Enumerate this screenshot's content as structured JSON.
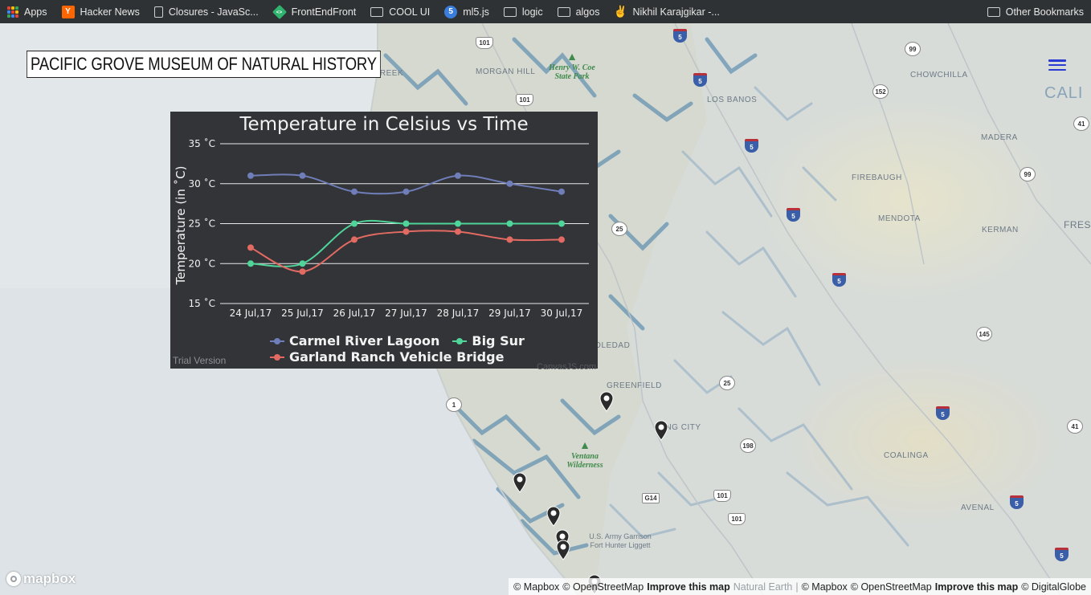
{
  "bookmarks": {
    "items": [
      {
        "label": "Apps",
        "icon": "apps-grid-icon"
      },
      {
        "label": "Hacker News",
        "icon": "hacker-news-icon"
      },
      {
        "label": "Closures - JavaSc...",
        "icon": "document-icon"
      },
      {
        "label": "FrontEndFront",
        "icon": "frontendfront-icon"
      },
      {
        "label": "COOL UI",
        "icon": "folder-icon"
      },
      {
        "label": "ml5.js",
        "icon": "ml5-icon"
      },
      {
        "label": "logic",
        "icon": "folder-icon"
      },
      {
        "label": "algos",
        "icon": "folder-icon"
      },
      {
        "label": "Nikhil Karajgikar -...",
        "icon": "peace-hand-icon"
      }
    ],
    "other": {
      "label": "Other Bookmarks",
      "icon": "folder-icon"
    }
  },
  "app": {
    "title": "PACIFIC GROVE MUSEUM OF NATURAL HISTORY",
    "menu_icon": "hamburger-menu-icon",
    "accent": "#2b3bd3"
  },
  "map": {
    "places": [
      "BOULDER CREEK",
      "MORGAN HILL",
      "LOS BANOS",
      "CHOWCHILLA",
      "CALI",
      "MADERA",
      "FIREBAUGH",
      "MENDOTA",
      "FRESN",
      "KERMAN",
      "SOLEDAD",
      "GREENFIELD",
      "KING CITY",
      "COALINGA",
      "AVENAL"
    ],
    "parks": [
      "Henry W. Coe State Park",
      "Ventana Wilderness",
      "U.S. Army Garrison Fort Hunter Liggett"
    ],
    "shields": [
      "101",
      "5",
      "99",
      "5",
      "152",
      "101",
      "41",
      "5",
      "99",
      "5",
      "25",
      "5",
      "145",
      "25",
      "1",
      "198",
      "5",
      "41",
      "101",
      "G14",
      "101",
      "5",
      "5"
    ],
    "marker_count": 7
  },
  "chart_data": {
    "type": "line",
    "title": "Temperature in Celsius vs Time",
    "xlabel": "",
    "ylabel": "Temperature (in ˚C)",
    "categories": [
      "24 Jul,17",
      "25 Jul,17",
      "26 Jul,17",
      "27 Jul,17",
      "28 Jul,17",
      "29 Jul,17",
      "30 Jul,17"
    ],
    "ylim": [
      15,
      35
    ],
    "yticks": [
      "15 ˚C",
      "20 ˚C",
      "25 ˚C",
      "30 ˚C",
      "35 ˚C"
    ],
    "grid": true,
    "legend": "bottom",
    "series": [
      {
        "name": "Carmel River Lagoon",
        "color": "#6f7db8",
        "values": [
          31,
          31,
          29,
          29,
          31,
          30,
          29
        ]
      },
      {
        "name": "Big Sur",
        "color": "#4fd49a",
        "values": [
          20,
          20,
          25,
          25,
          25,
          25,
          25
        ]
      },
      {
        "name": "Garland Ranch Vehicle Bridge",
        "color": "#e36a62",
        "values": [
          22,
          19,
          23,
          24,
          24,
          23,
          23
        ]
      }
    ],
    "footer_left": "Trial Version",
    "footer_right": "CanvasJS.com"
  },
  "attribution": {
    "mapbox_logo": "mapbox",
    "items": [
      "© Mapbox",
      "© OpenStreetMap",
      "Improve this map",
      "Natural Earth",
      "|",
      "© Mapbox",
      "© OpenStreetMap",
      "Improve this map",
      "© DigitalGlobe"
    ]
  }
}
